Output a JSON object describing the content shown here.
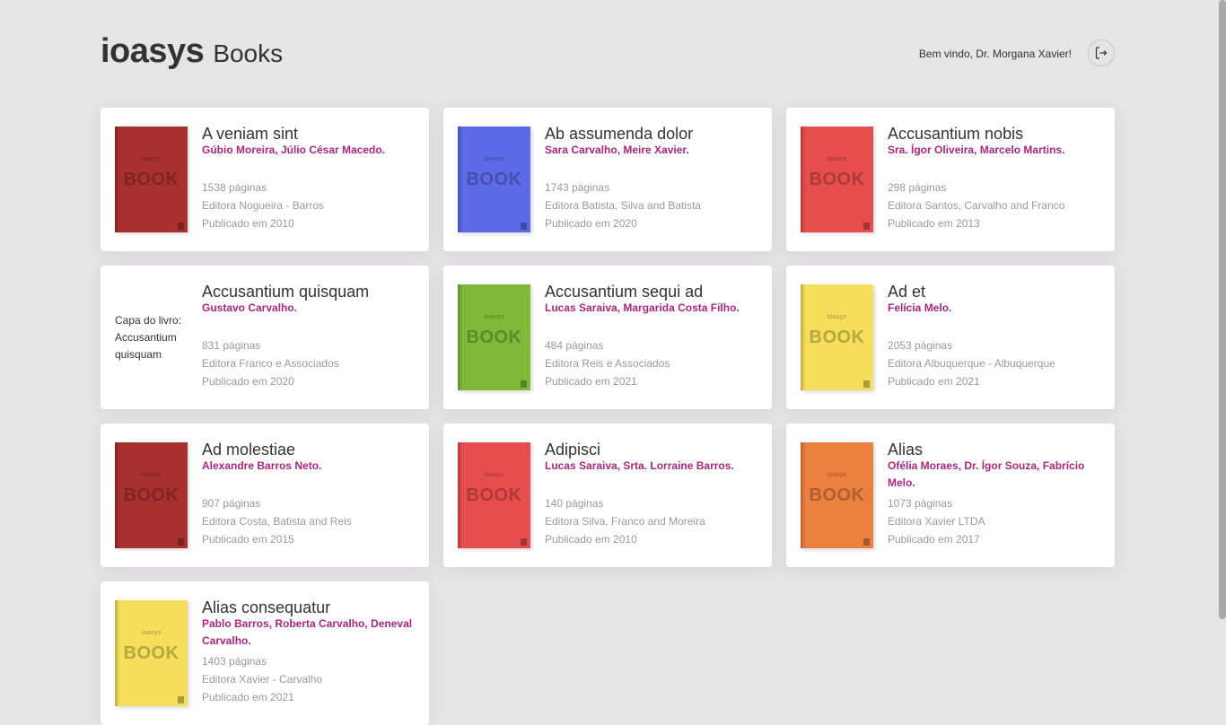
{
  "header": {
    "brand": "ioasys",
    "title": "Books",
    "welcome": "Bem vindo, Dr. Morgana Xavier!",
    "logout_icon": "logout-icon"
  },
  "cover_text": {
    "brand": "ioasys",
    "book": "BOOK"
  },
  "books": [
    {
      "title": "A veniam sint",
      "authors": "Gúbio Moreira, Júlio César Macedo.",
      "pages": "1538 páginas",
      "publisher": "Editora Nogueira - Barros",
      "published": "Publicado em 2010",
      "cover_color": "#a8302e"
    },
    {
      "title": "Ab assumenda dolor",
      "authors": "Sara Carvalho, Meire Xavier.",
      "pages": "1743 páginas",
      "publisher": "Editora Batista, Silva and Batista",
      "published": "Publicado em 2020",
      "cover_color": "#5d6ae8"
    },
    {
      "title": "Accusantium nobis",
      "authors": "Sra. Ígor Oliveira, Marcelo Martins.",
      "pages": "298 páginas",
      "publisher": "Editora Santos, Carvalho and Franco",
      "published": "Publicado em 2013",
      "cover_color": "#e84d4d"
    },
    {
      "title": "Accusantium quisquam",
      "authors": "Gustavo Carvalho.",
      "pages": "831 páginas",
      "publisher": "Editora Franco e Associados",
      "published": "Publicado em 2020",
      "cover_color": "",
      "cover_alt": "Capa do livro: Accusantium quisquam"
    },
    {
      "title": "Accusantium sequi ad",
      "authors": "Lucas Saraiva, Margarida Costa Filho.",
      "pages": "484 páginas",
      "publisher": "Editora Reis e Associados",
      "published": "Publicado em 2021",
      "cover_color": "#7fb93a"
    },
    {
      "title": "Ad et",
      "authors": "Felícia Melo.",
      "pages": "2053 páginas",
      "publisher": "Editora Albuquerque - Albuquerque",
      "published": "Publicado em 2021",
      "cover_color": "#f5df5a"
    },
    {
      "title": "Ad molestiae",
      "authors": "Alexandre Barros Neto.",
      "pages": "907 páginas",
      "publisher": "Editora Costa, Batista and Reis",
      "published": "Publicado em 2015",
      "cover_color": "#a8302e"
    },
    {
      "title": "Adipisci",
      "authors": "Lucas Saraiva, Srta. Lorraine Barros.",
      "pages": "140 páginas",
      "publisher": "Editora Silva, Franco and Moreira",
      "published": "Publicado em 2010",
      "cover_color": "#e84d4d"
    },
    {
      "title": "Alias",
      "authors": "Ofélia Moraes, Dr. Ígor Souza, Fabrício Melo.",
      "pages": "1073 páginas",
      "publisher": "Editora Xavier LTDA",
      "published": "Publicado em 2017",
      "cover_color": "#eb8040"
    },
    {
      "title": "Alias consequatur",
      "authors": "Pablo Barros, Roberta Carvalho, Deneval Carvalho.",
      "pages": "1403 páginas",
      "publisher": "Editora Xavier - Carvalho",
      "published": "Publicado em 2021",
      "cover_color": "#f5df5a"
    }
  ]
}
